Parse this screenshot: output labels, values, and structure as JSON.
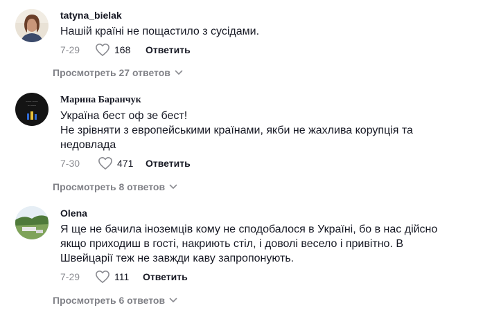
{
  "comments": [
    {
      "username": "tatyna_bielak",
      "avatar_icon": "user-avatar-photo",
      "lines": [
        "Нашій країні не пощастило з сусідами."
      ],
      "date": "7-29",
      "likes": "168",
      "reply_label": "Ответить",
      "view_replies": "Просмотреть 27 ответов"
    },
    {
      "username": "Марина Баранчук",
      "avatar_icon": "user-avatar-dark-image",
      "lines": [
        "Україна бест оф зе бест!",
        "Не зрівняти з европейськими країнами, якби не жахлива корупція та",
        "недовлада"
      ],
      "date": "7-30",
      "likes": "471",
      "reply_label": "Ответить",
      "view_replies": "Просмотреть 8 ответов"
    },
    {
      "username": "Olena",
      "avatar_icon": "user-avatar-landscape",
      "lines": [
        "Я ще не бачила іноземців кому не сподобалося в Україні, бо в нас дійсно",
        "якщо приходиш в гості, накриють стіл, і доволі весело і привітно. В",
        "Швейцарії теж не завжди каву запропонують."
      ],
      "date": "7-29",
      "likes": "111",
      "reply_label": "Ответить",
      "view_replies": "Просмотреть 6 ответов"
    }
  ],
  "colors": {
    "text": "#161823",
    "muted": "#8a8b91",
    "background": "#ffffff"
  }
}
